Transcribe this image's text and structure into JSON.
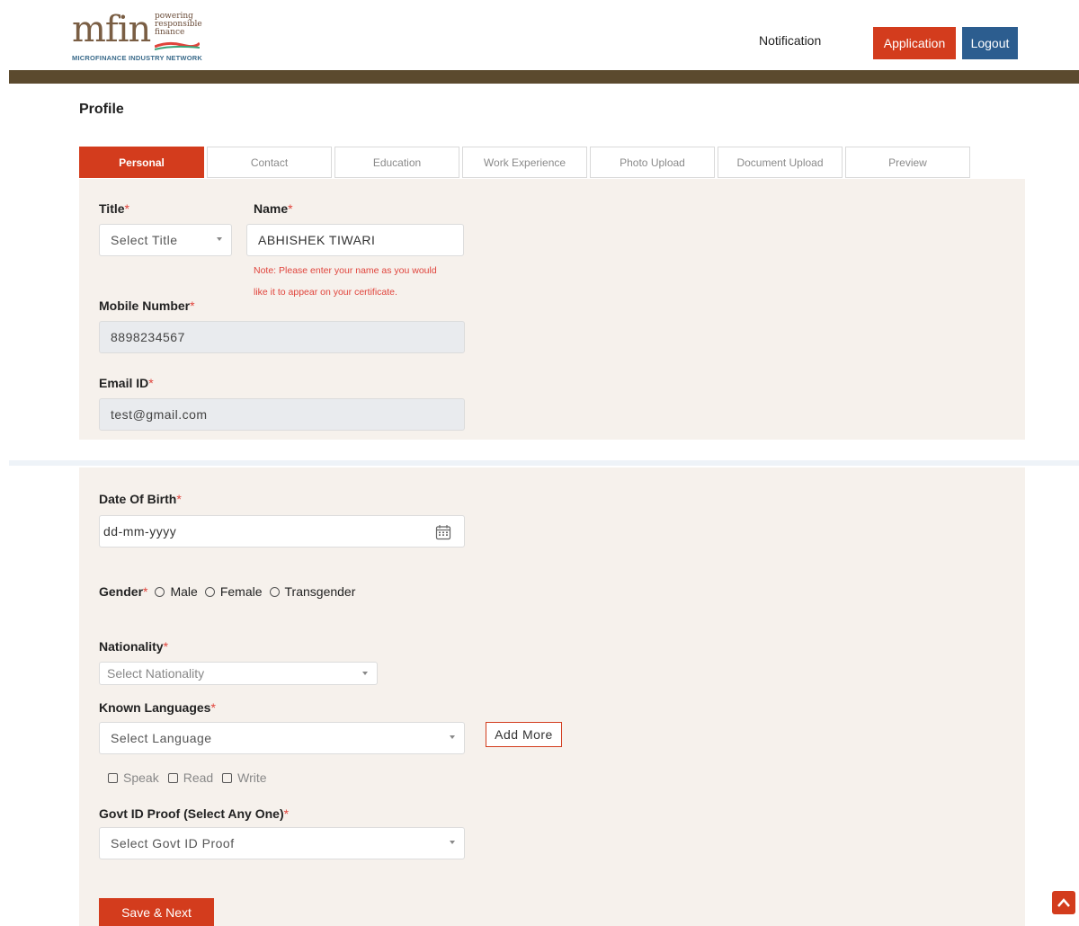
{
  "header": {
    "logo_text": "mfin",
    "logo_tagline": [
      "powering",
      "responsible",
      "finance"
    ],
    "logo_subtitle": "MICROFINANCE INDUSTRY NETWORK",
    "notification": "Notification",
    "application": "Application",
    "logout": "Logout"
  },
  "page": {
    "title": "Profile"
  },
  "tabs": [
    {
      "label": "Personal",
      "active": true
    },
    {
      "label": "Contact"
    },
    {
      "label": "Education"
    },
    {
      "label": "Work Experience"
    },
    {
      "label": "Photo Upload"
    },
    {
      "label": "Document Upload"
    },
    {
      "label": "Preview"
    }
  ],
  "form": {
    "title": {
      "label": "Title",
      "required": "*",
      "value": "Select Title"
    },
    "name": {
      "label": "Name",
      "required": "*",
      "value": "ABHISHEK TIWARI",
      "note_line1": "Note: Please enter your name as you would",
      "note_line2": "like it to appear on your certificate."
    },
    "mobile": {
      "label": "Mobile Number",
      "required": "*",
      "value": "8898234567"
    },
    "email": {
      "label": "Email ID",
      "required": "*",
      "value": "test@gmail.com"
    },
    "dob": {
      "label": "Date Of Birth",
      "required": "*",
      "placeholder": "dd-mm-yyyy"
    },
    "gender": {
      "label": "Gender",
      "required": "*",
      "options": [
        "Male",
        "Female",
        "Transgender"
      ]
    },
    "nationality": {
      "label": "Nationality",
      "required": "*",
      "placeholder": "Select Nationality"
    },
    "languages": {
      "label": "Known Languages",
      "required": "*",
      "placeholder": "Select Language",
      "add_more": "Add More",
      "abilities": [
        "Speak",
        "Read",
        "Write"
      ]
    },
    "govt_id": {
      "label": "Govt ID Proof (Select Any One)",
      "required": "*",
      "placeholder": "Select Govt ID Proof"
    },
    "save_next": "Save & Next"
  },
  "colors": {
    "accent": "#d33c1d",
    "logout_blue": "#2c5d8f",
    "header_bar": "#5b4a2e",
    "panel_bg": "#f6f1ec"
  },
  "icons": {
    "calendar": "calendar-icon",
    "scroll_top": "chevron-up-icon"
  }
}
